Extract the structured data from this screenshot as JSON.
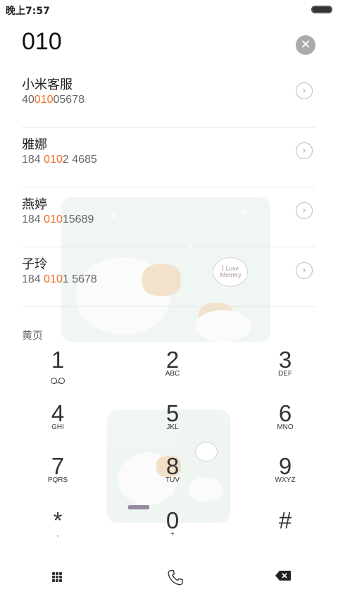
{
  "status_bar": {
    "time": "晚上7:57"
  },
  "dialer": {
    "number": "010",
    "clear_icon": "clear-icon"
  },
  "results": [
    {
      "name": "小米客服",
      "number_pre": "40",
      "number_match": "010",
      "number_post": "05678"
    },
    {
      "name": "雅娜",
      "number_pre": "184 ",
      "number_match": "010",
      "number_post": "2 4685"
    },
    {
      "name": "燕婷",
      "number_pre": "184 ",
      "number_match": "010",
      "number_post": "15689"
    },
    {
      "name": "子玲",
      "number_pre": "184 ",
      "number_match": "010",
      "number_post": "1 5678"
    }
  ],
  "section_label": "黄页",
  "keypad": [
    {
      "digit": "1",
      "letters": ""
    },
    {
      "digit": "2",
      "letters": "ABC"
    },
    {
      "digit": "3",
      "letters": "DEF"
    },
    {
      "digit": "4",
      "letters": "GHI"
    },
    {
      "digit": "5",
      "letters": "JKL"
    },
    {
      "digit": "6",
      "letters": "MNO"
    },
    {
      "digit": "7",
      "letters": "PQRS"
    },
    {
      "digit": "8",
      "letters": "TUV"
    },
    {
      "digit": "9",
      "letters": "WXYZ"
    },
    {
      "digit": "*",
      "letters": ","
    },
    {
      "digit": "0",
      "letters": "+"
    },
    {
      "digit": "#",
      "letters": ""
    }
  ],
  "bottom_bar": {
    "left_icon": "dialpad-grid-icon",
    "center_icon": "phone-call-icon",
    "right_icon": "backspace-icon"
  },
  "colors": {
    "highlight": "#f06a21"
  },
  "wallpaper": {
    "bubble_text": "I Love Mimmy"
  }
}
